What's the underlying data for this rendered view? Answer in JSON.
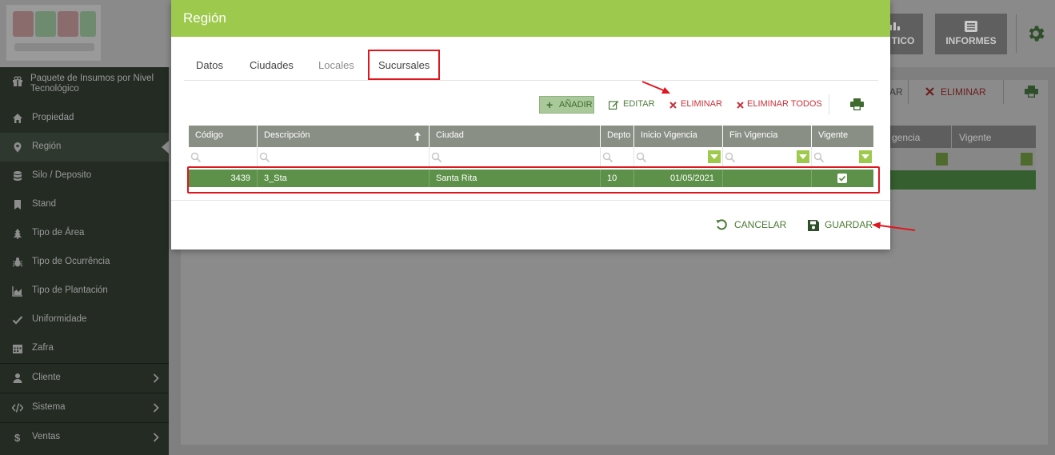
{
  "app": {
    "top_buttons": [
      {
        "label": "TICO",
        "icon": "chart-icon"
      },
      {
        "label": "INFORMES",
        "icon": "list-icon"
      }
    ]
  },
  "sidebar": {
    "items": [
      {
        "label": "Paquete de Insumos por Nivel Tecnológico",
        "icon": "gift-icon"
      },
      {
        "label": "Propiedad",
        "icon": "home-icon"
      },
      {
        "label": "Región",
        "icon": "map-marker-icon",
        "active": true
      },
      {
        "label": "Silo / Deposito",
        "icon": "database-icon"
      },
      {
        "label": "Stand",
        "icon": "bookmark-icon"
      },
      {
        "label": "Tipo de Área",
        "icon": "tree-icon"
      },
      {
        "label": "Tipo de Ocurrência",
        "icon": "bug-icon"
      },
      {
        "label": "Tipo de Plantación",
        "icon": "area-chart-icon"
      },
      {
        "label": "Uniformidade",
        "icon": "check-icon"
      },
      {
        "label": "Zafra",
        "icon": "calendar-icon"
      },
      {
        "label": "Cliente",
        "icon": "user-icon"
      },
      {
        "label": "Sistema",
        "icon": "code-icon"
      },
      {
        "label": "Ventas",
        "icon": "dollar-icon"
      }
    ]
  },
  "background": {
    "toolbar": {
      "edit_fragment": "AR",
      "delete_label": "ELIMINAR"
    },
    "columns": [
      "gencia",
      "Vigente"
    ]
  },
  "modal": {
    "title": "Región",
    "tabs": [
      "Datos",
      "Ciudades",
      "Locales",
      "Sucursales"
    ],
    "active_tab": "Sucursales",
    "toolbar": {
      "add": "AÑADIR",
      "edit": "EDITAR",
      "delete": "ELIMINAR",
      "delete_all": "ELIMINAR TODOS"
    },
    "grid": {
      "columns": [
        "Código",
        "Descripción",
        "Ciudad",
        "Depto",
        "Inicio Vigencia",
        "Fin Vigencia",
        "Vigente"
      ],
      "rows": [
        {
          "codigo": "3439",
          "descripcion": "3_Sta",
          "ciudad": "Santa Rita",
          "depto": "10",
          "inicio": "01/05/2021",
          "fin": "",
          "vigente": true
        }
      ]
    },
    "footer": {
      "cancel": "CANCELAR",
      "save": "GUARDAR"
    }
  },
  "colors": {
    "accent": "#9dc94c",
    "row_selected": "#5d9149",
    "danger": "#c8323a",
    "highlight_box": "#e0161e"
  }
}
